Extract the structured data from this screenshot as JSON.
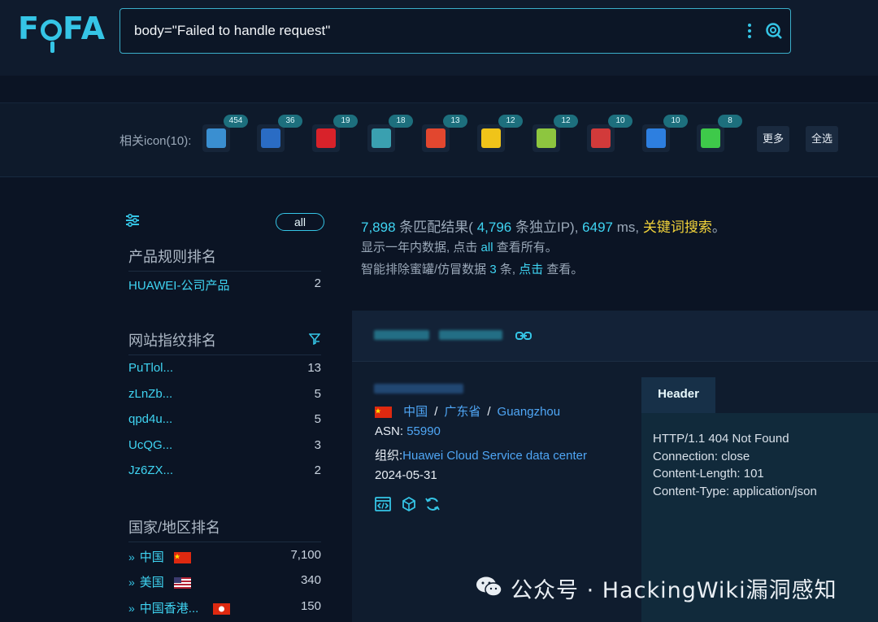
{
  "header": {
    "logo": "FOFA",
    "query": "body=\"Failed to handle request\""
  },
  "icons_bar": {
    "label": "相关icon(10):",
    "icons": [
      {
        "name": "globe-ie-icon",
        "count": "454",
        "color": "#3a8fd1"
      },
      {
        "name": "blue-wave-icon",
        "count": "36",
        "color": "#2a6cc4"
      },
      {
        "name": "v-logo-icon",
        "count": "19",
        "color": "#d8222a"
      },
      {
        "name": "layers-icon",
        "count": "18",
        "color": "#3aa0b0"
      },
      {
        "name": "red-ring-icon",
        "count": "13",
        "color": "#e2472f"
      },
      {
        "name": "yellow-badge-icon",
        "count": "12",
        "color": "#f0c419"
      },
      {
        "name": "leaf-icon",
        "count": "12",
        "color": "#8dc63f"
      },
      {
        "name": "red-horse-icon",
        "count": "10",
        "color": "#d23a3a"
      },
      {
        "name": "blue-cloud-icon",
        "count": "10",
        "color": "#2d7fe0"
      },
      {
        "name": "green-b-icon",
        "count": "8",
        "color": "#3ec94a"
      }
    ],
    "more_label": "更多",
    "select_all_label": "全选"
  },
  "sidebar": {
    "all_label": "all",
    "product_title": "产品规则排名",
    "products": [
      {
        "name": "HUAWEI-公司产品",
        "count": "2"
      }
    ],
    "fingerprint_title": "网站指纹排名",
    "fingerprints": [
      {
        "name": "PuTlol...",
        "count": "13"
      },
      {
        "name": "zLnZb...",
        "count": "5"
      },
      {
        "name": "qpd4u...",
        "count": "5"
      },
      {
        "name": "UcQG...",
        "count": "3"
      },
      {
        "name": "Jz6ZX...",
        "count": "2"
      }
    ],
    "country_title": "国家/地区排名",
    "countries": [
      {
        "name": "中国",
        "count": "7,100"
      },
      {
        "name": "美国",
        "count": "340"
      },
      {
        "name": "中国香港...",
        "count": "150"
      }
    ]
  },
  "summary": {
    "match_count": "7,898",
    "match_text": "条匹配结果(",
    "ip_count": "4,796",
    "ip_text": "条独立IP),",
    "ms": "6497",
    "ms_unit": "ms,",
    "keyword": "关键词搜索",
    "period": "。",
    "line2_a": "显示一年内数据, 点击",
    "line2_all": "all",
    "line2_b": "查看所有。",
    "line3_a": "智能排除蜜罐/仿冒数据",
    "line3_num": "3",
    "line3_b": "条,",
    "line3_click": "点击",
    "line3_c": "查看。"
  },
  "result": {
    "country": "中国",
    "sep": "/",
    "province": "广东省",
    "city": "Guangzhou",
    "asn_label": "ASN:",
    "asn": "55990",
    "org_label": "组织:",
    "org": "Huawei Cloud Service data center",
    "date": "2024-05-31",
    "header_tab": "Header",
    "header_lines": [
      "HTTP/1.1 404 Not Found",
      "Connection: close",
      "Content-Length: 101",
      "Content-Type: application/json"
    ]
  },
  "watermark": "公众号 · HackingWiki漏洞感知"
}
